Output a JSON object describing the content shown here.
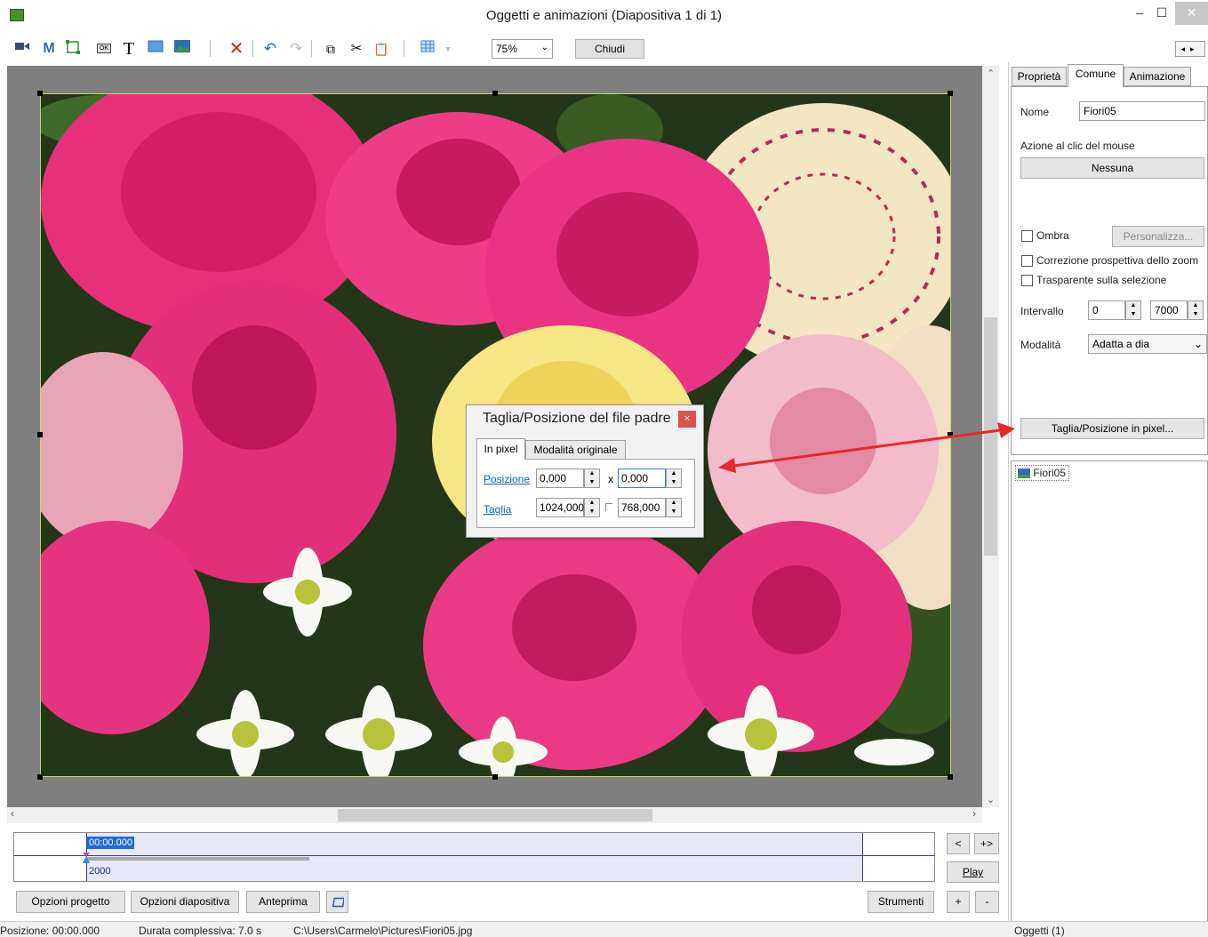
{
  "window": {
    "title": "Oggetti e animazioni  (Diapositiva 1 di 1)",
    "minimize": "‒",
    "maximize": "☐",
    "close": "✕"
  },
  "toolbar": {
    "zoom": "75%",
    "close_label": "Chiudi",
    "m_label": "M",
    "t_label": "T",
    "ok_label": "OK"
  },
  "crop_dialog": {
    "title": "Taglia/Posizione del file padre",
    "close": "×",
    "tabs": [
      "In pixel",
      "Modalità originale"
    ],
    "position_label": "Posizione",
    "position_x": "0,000",
    "position_y": "0,000",
    "x_sep": "x",
    "crop_label": "Taglia",
    "crop_w": "1024,000",
    "crop_h": "768,000"
  },
  "panel": {
    "tabs": [
      "Proprietà",
      "Comune",
      "Animazione"
    ],
    "name_label": "Nome",
    "name_value": "Fiori05",
    "mouse_action_label": "Azione al clic del mouse",
    "mouse_action_value": "Nessuna",
    "shadow_label": "Ombra",
    "customize_label": "Personalizza...",
    "zoom_perspective_label": "Correzione prospettiva dello zoom",
    "transparent_label": "Trasparente sulla selezione",
    "interval_label": "Intervallo",
    "interval_start": "0",
    "interval_end": "7000",
    "mode_label": "Modalità",
    "mode_value": "Adatta a dia",
    "crop_button": "Taglia/Posizione in pixel...",
    "objects": [
      "Fiori05"
    ]
  },
  "timeline": {
    "time": "00:00.000",
    "marker_value": "2000",
    "prev": "<",
    "next": "+>",
    "play": "Play"
  },
  "bottom_buttons": {
    "project_options": "Opzioni progetto",
    "slide_options": "Opzioni diapositiva",
    "preview": "Anteprima",
    "tools": "Strumenti",
    "plus": "+",
    "minus": "-"
  },
  "status": {
    "position": "Posizione:  00:00.000",
    "duration": "Durata complessiva:  7.0 s",
    "path": "C:\\Users\\Carmelo\\Pictures\\Fiori05.jpg",
    "objects": "Oggetti (1)"
  },
  "colors": {
    "accent": "#1f6bd1",
    "link": "#0066cc",
    "arrow": "#e8262b"
  }
}
